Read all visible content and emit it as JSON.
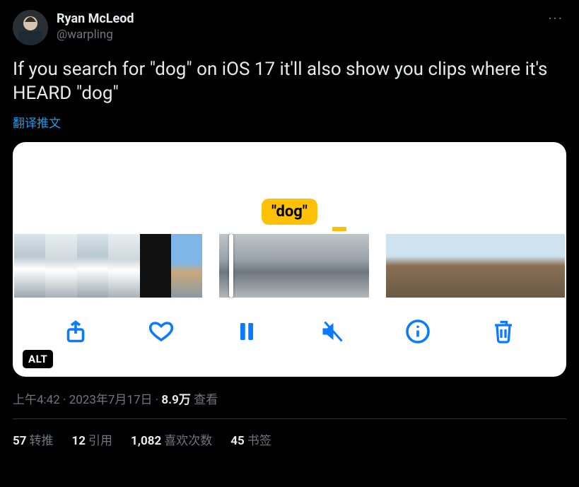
{
  "author": {
    "name": "Ryan McLeod",
    "handle": "@warpling"
  },
  "more_label": "···",
  "body": "If you search for \"dog\" on iOS 17 it'll also show you clips where it's HEARD \"dog\"",
  "translate": "翻译推文",
  "media": {
    "marker": "\"dog\"",
    "alt_badge": "ALT"
  },
  "meta": {
    "time": "上午4:42",
    "sep": " · ",
    "date": "2023年7月17日",
    "views_n": "8.9万",
    "views_label": " 查看"
  },
  "stats": {
    "retweets_n": "57",
    "retweets_l": "转推",
    "quotes_n": "12",
    "quotes_l": "引用",
    "likes_n": "1,082",
    "likes_l": "喜欢次数",
    "bookmarks_n": "45",
    "bookmarks_l": "书签"
  }
}
